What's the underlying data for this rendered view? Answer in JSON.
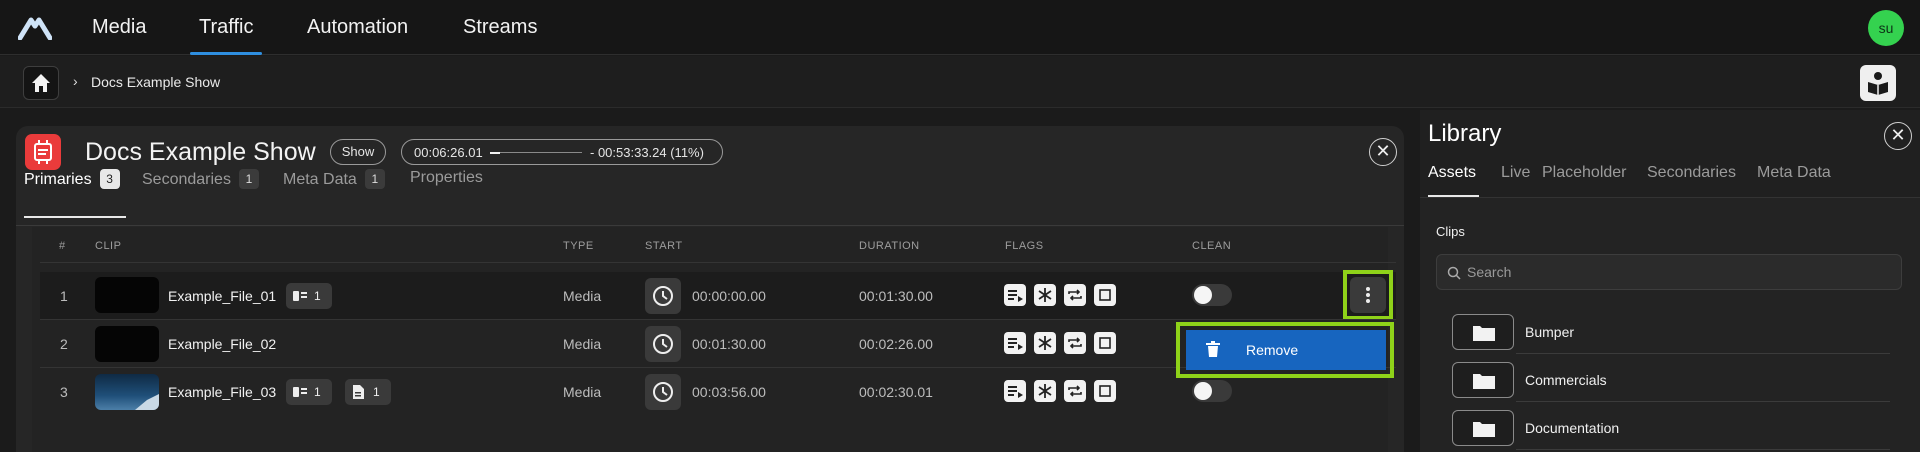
{
  "nav": {
    "tabs": [
      {
        "label": "Media"
      },
      {
        "label": "Traffic"
      },
      {
        "label": "Automation"
      },
      {
        "label": "Streams"
      }
    ],
    "active_tab": "Traffic",
    "avatar_initials": "su"
  },
  "breadcrumb": {
    "current": "Docs Example Show"
  },
  "show": {
    "title": "Docs Example Show",
    "type_pill": "Show",
    "timing": {
      "start": "00:06:26.01",
      "end": "- 00:53:33.24 (11%)",
      "progress_fraction": 0.11
    },
    "tabs": [
      {
        "label": "Primaries",
        "count": "3"
      },
      {
        "label": "Secondaries",
        "count": "1"
      },
      {
        "label": "Meta Data",
        "count": "1"
      },
      {
        "label": "Properties",
        "count": ""
      }
    ]
  },
  "table": {
    "headers": {
      "num": "#",
      "clip": "CLIP",
      "type": "TYPE",
      "start": "START",
      "duration": "DURATION",
      "flags": "FLAGS",
      "clean": "CLEAN"
    },
    "rows": [
      {
        "num": "1",
        "clip": "Example_File_01",
        "chips": [
          "1"
        ],
        "type": "Media",
        "start": "00:00:00.00",
        "duration": "00:01:30.00",
        "clean": false
      },
      {
        "num": "2",
        "clip": "Example_File_02",
        "chips": [],
        "type": "Media",
        "start": "00:01:30.00",
        "duration": "00:02:26.00",
        "clean": false
      },
      {
        "num": "3",
        "clip": "Example_File_03",
        "chips": [
          "1",
          "1"
        ],
        "type": "Media",
        "start": "00:03:56.00",
        "duration": "00:02:30.01",
        "clean": false
      }
    ]
  },
  "context_menu": {
    "remove_label": "Remove"
  },
  "library": {
    "title": "Library",
    "tabs": [
      "Assets",
      "Live",
      "Placeholder",
      "Secondaries",
      "Meta Data"
    ],
    "section_label": "Clips",
    "search_placeholder": "Search",
    "folders": [
      "Bumper",
      "Commercials",
      "Documentation"
    ]
  },
  "colors": {
    "accent": "#2f8fe0",
    "highlight": "#8fd219",
    "menu": "#1765bf",
    "show_icon": "#ea3b3b",
    "avatar": "#34d24f"
  }
}
